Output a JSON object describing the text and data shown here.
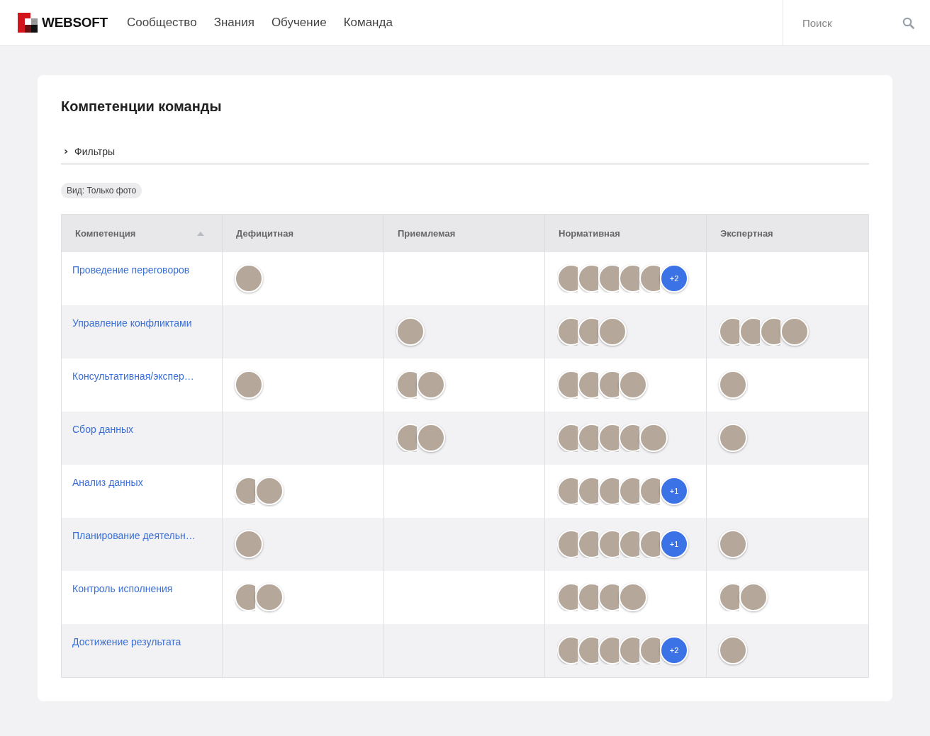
{
  "header": {
    "logo": "WEBSOFT",
    "nav": [
      {
        "label": "Сообщество"
      },
      {
        "label": "Знания"
      },
      {
        "label": "Обучение"
      },
      {
        "label": "Команда"
      }
    ],
    "search": {
      "placeholder": "Поиск"
    }
  },
  "page": {
    "title": "Компетенции команды",
    "filters": {
      "label": "Фильтры",
      "expanded": false
    },
    "chip": "Вид: Только фото"
  },
  "table": {
    "columns": [
      {
        "label": "Компетенция",
        "sorted": true
      },
      {
        "label": "Дефицитная",
        "sorted": false
      },
      {
        "label": "Приемлемая",
        "sorted": false
      },
      {
        "label": "Нормативная",
        "sorted": false
      },
      {
        "label": "Экспертная",
        "sorted": false
      }
    ],
    "rows": [
      {
        "name": "Проведение переговоров",
        "cells": [
          {
            "avatars": [
              {
                "kind": "photo"
              }
            ]
          },
          {},
          {
            "avatars": [
              {
                "kind": "photo"
              },
              {
                "kind": "photo"
              },
              {
                "kind": "photo"
              },
              {
                "kind": "photo"
              },
              {
                "kind": "photo"
              }
            ],
            "more": "+2"
          },
          {}
        ]
      },
      {
        "name": "Управление конфликтами",
        "cells": [
          {},
          {
            "avatars": [
              {
                "kind": "photo"
              }
            ]
          },
          {
            "avatars": [
              {
                "kind": "photo"
              },
              {
                "kind": "photo"
              },
              {
                "kind": "photo"
              }
            ]
          },
          {
            "avatars": [
              {
                "kind": "photo"
              },
              {
                "kind": "photo"
              },
              {
                "kind": "photo"
              },
              {
                "kind": "photo"
              }
            ]
          }
        ]
      },
      {
        "name": "Консультативная/экспер…",
        "cells": [
          {
            "avatars": [
              {
                "kind": "photo"
              }
            ]
          },
          {
            "avatars": [
              {
                "kind": "photo"
              },
              {
                "kind": "photo"
              }
            ]
          },
          {
            "avatars": [
              {
                "kind": "photo"
              },
              {
                "kind": "photo"
              },
              {
                "kind": "photo"
              },
              {
                "kind": "photo"
              }
            ]
          },
          {
            "avatars": [
              {
                "kind": "photo"
              }
            ]
          }
        ]
      },
      {
        "name": "Сбор данных",
        "cells": [
          {},
          {
            "avatars": [
              {
                "kind": "photo"
              },
              {
                "kind": "photo"
              }
            ]
          },
          {
            "avatars": [
              {
                "kind": "photo"
              },
              {
                "kind": "photo"
              },
              {
                "kind": "photo"
              },
              {
                "kind": "photo"
              },
              {
                "kind": "photo"
              }
            ]
          },
          {
            "avatars": [
              {
                "kind": "photo"
              }
            ]
          }
        ]
      },
      {
        "name": "Анализ данных",
        "cells": [
          {
            "avatars": [
              {
                "kind": "photo"
              },
              {
                "kind": "photo"
              }
            ]
          },
          {},
          {
            "avatars": [
              {
                "kind": "photo"
              },
              {
                "kind": "photo"
              },
              {
                "kind": "photo"
              },
              {
                "kind": "photo"
              },
              {
                "kind": "photo"
              }
            ],
            "more": "+1"
          },
          {}
        ]
      },
      {
        "name": "Планирование деятельн…",
        "cells": [
          {
            "avatars": [
              {
                "kind": "photo"
              }
            ]
          },
          {},
          {
            "avatars": [
              {
                "kind": "photo"
              },
              {
                "kind": "photo"
              },
              {
                "kind": "photo"
              },
              {
                "kind": "photo"
              },
              {
                "kind": "photo"
              }
            ],
            "more": "+1"
          },
          {
            "avatars": [
              {
                "kind": "photo"
              }
            ]
          }
        ]
      },
      {
        "name": "Контроль исполнения",
        "cells": [
          {
            "avatars": [
              {
                "kind": "photo"
              },
              {
                "kind": "photo"
              }
            ]
          },
          {},
          {
            "avatars": [
              {
                "kind": "photo"
              },
              {
                "kind": "photo"
              },
              {
                "kind": "photo"
              },
              {
                "kind": "photo"
              }
            ]
          },
          {
            "avatars": [
              {
                "kind": "photo"
              },
              {
                "kind": "photo"
              }
            ]
          }
        ]
      },
      {
        "name": "Достижение результата",
        "cells": [
          {},
          {},
          {
            "avatars": [
              {
                "kind": "photo"
              },
              {
                "kind": "photo"
              },
              {
                "kind": "photo"
              },
              {
                "kind": "photo"
              },
              {
                "kind": "photo"
              }
            ],
            "more": "+2"
          },
          {
            "avatars": [
              {
                "kind": "photo"
              }
            ]
          }
        ]
      }
    ]
  }
}
